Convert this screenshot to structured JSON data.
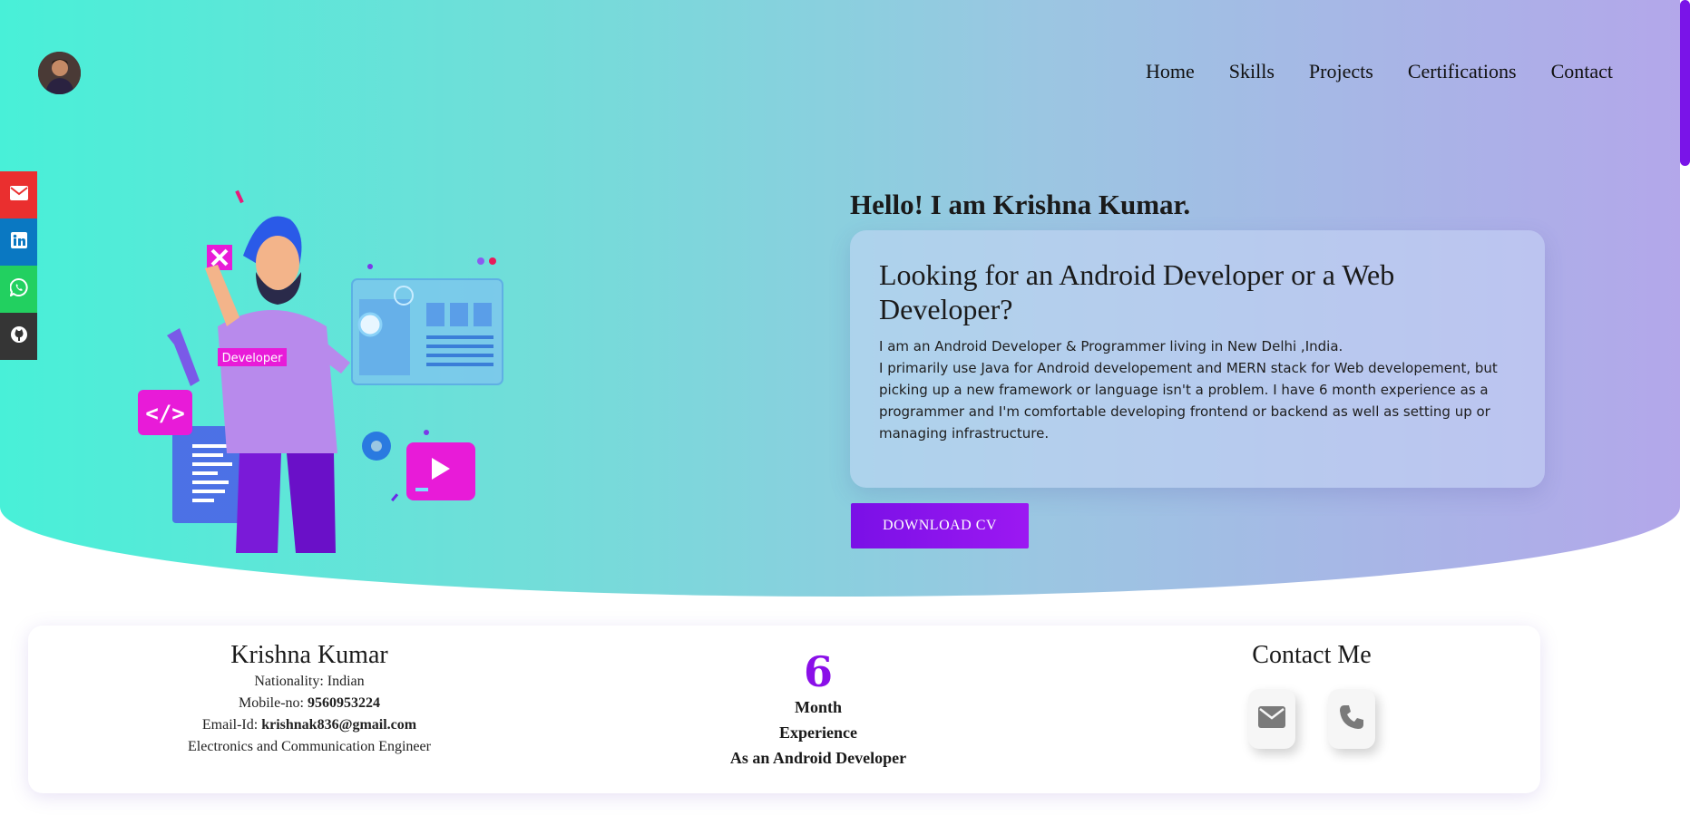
{
  "nav": {
    "items": [
      "Home",
      "Skills",
      "Projects",
      "Certifications",
      "Contact"
    ]
  },
  "social": [
    "email-icon",
    "linkedin-icon",
    "whatsapp-icon",
    "github-icon"
  ],
  "hero": {
    "greeting": "Hello! I am Krishna Kumar.",
    "card_heading": "Looking for an Android Developer or a Web Developer?",
    "card_line1": "I am an Android Developer & Programmer living in New Delhi ,India.",
    "card_line2": "I primarily use Java for Android developement and MERN stack for Web developement, but picking up a new framework or language isn't a problem. I have 6 month experience as a programmer and I'm comfortable developing frontend or backend as well as setting up or managing infrastructure.",
    "cv_button": "DOWNLOAD CV",
    "illustration_badge": "Developer"
  },
  "profile": {
    "name": "Krishna Kumar",
    "nationality_label": "Nationality: ",
    "nationality": "Indian",
    "mobile_label": "Mobile-no: ",
    "mobile": "9560953224",
    "email_label": "Email-Id: ",
    "email": "krishnak836@gmail.com",
    "degree": "Electronics and Communication Engineer"
  },
  "experience": {
    "number": "6",
    "line1": "Month",
    "line2": "Experience",
    "line3": "As an Android Developer"
  },
  "contact": {
    "title": "Contact Me",
    "icons": [
      "envelope-icon",
      "phone-icon"
    ]
  },
  "colors": {
    "accent": "#8a0fe8",
    "gradient_start": "#48f0d8",
    "gradient_end": "#b3a7ea",
    "email": "#ea2f2f",
    "linkedin": "#0a78c2",
    "whatsapp": "#22d060",
    "github": "#353535"
  }
}
